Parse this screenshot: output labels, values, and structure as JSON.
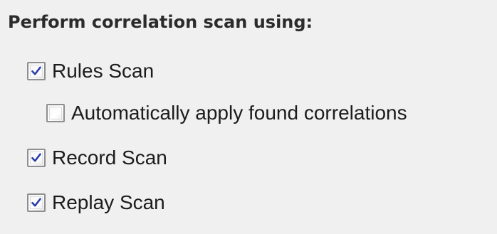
{
  "section": {
    "heading": "Perform correlation scan using:"
  },
  "options": [
    {
      "label": "Rules Scan",
      "checked": true
    },
    {
      "label": "Automatically apply found correlations",
      "checked": false
    },
    {
      "label": "Record Scan",
      "checked": true
    },
    {
      "label": "Replay Scan",
      "checked": true
    }
  ],
  "colors": {
    "background": "#f0f0f0",
    "checkmark": "#2a3fa8",
    "checkbox_border": "#8e8f8f"
  },
  "icons": {
    "checked": "checkmark-icon"
  }
}
